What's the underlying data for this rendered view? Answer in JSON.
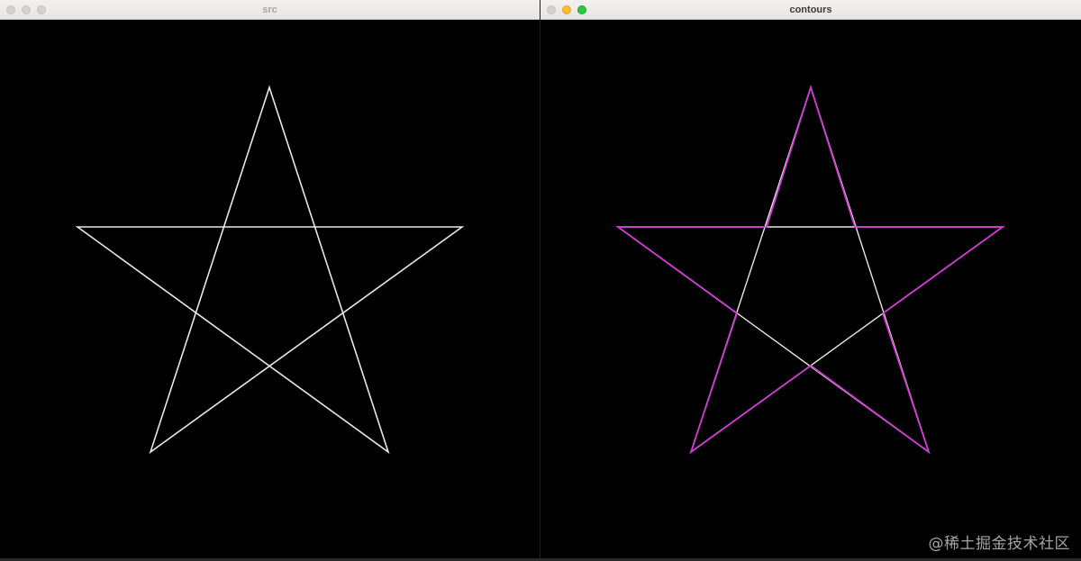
{
  "windows": [
    {
      "id": "src",
      "title": "src",
      "active": false,
      "star_color": "#e8e8e8"
    },
    {
      "id": "contours",
      "title": "contours",
      "active": true,
      "star_color": "#e8e8e8",
      "contour_color": "#d23ad6"
    }
  ],
  "watermark": "@稀土掘金技术社区",
  "colors": {
    "canvas_background": "#000000",
    "close": "#fe5f57",
    "minimize": "#febc2e",
    "zoom": "#28c840"
  }
}
